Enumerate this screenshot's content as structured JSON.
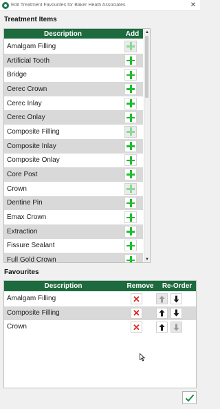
{
  "window": {
    "title": "Edit Treatment Favourites for Baker Heath Associates",
    "close_glyph": "✕",
    "app_icon": "app-logo-icon"
  },
  "treatment_items": {
    "section_title": "Treatment Items",
    "headers": {
      "description": "Description",
      "add": "Add"
    },
    "rows": [
      {
        "label": "Amalgam Filling",
        "add_enabled": false
      },
      {
        "label": "Artificial Tooth",
        "add_enabled": true
      },
      {
        "label": "Bridge",
        "add_enabled": true
      },
      {
        "label": "Cerec Crown",
        "add_enabled": true
      },
      {
        "label": "Cerec Inlay",
        "add_enabled": true
      },
      {
        "label": "Cerec Onlay",
        "add_enabled": true
      },
      {
        "label": "Composite Filling",
        "add_enabled": false
      },
      {
        "label": "Composite Inlay",
        "add_enabled": true
      },
      {
        "label": "Composite Onlay",
        "add_enabled": true
      },
      {
        "label": "Core Post",
        "add_enabled": true
      },
      {
        "label": "Crown",
        "add_enabled": false
      },
      {
        "label": "Dentine Pin",
        "add_enabled": true
      },
      {
        "label": "Emax Crown",
        "add_enabled": true
      },
      {
        "label": "Extraction",
        "add_enabled": true
      },
      {
        "label": "Fissure Sealant",
        "add_enabled": true
      },
      {
        "label": "Full Gold Crown",
        "add_enabled": true
      }
    ],
    "scroll_position": 0.0
  },
  "favourites": {
    "section_title": "Favourites",
    "headers": {
      "description": "Description",
      "remove": "Remove",
      "reorder": "Re-Order"
    },
    "rows": [
      {
        "label": "Amalgam Filling",
        "up_enabled": false,
        "down_enabled": true
      },
      {
        "label": "Composite Filling",
        "up_enabled": true,
        "down_enabled": true
      },
      {
        "label": "Crown",
        "up_enabled": true,
        "down_enabled": false
      }
    ]
  },
  "colors": {
    "header_green": "#1c6a3d",
    "plus_green": "#1fbd2f",
    "remove_red": "#e0241b",
    "row_alt": "#d9d9d9"
  },
  "icons": {
    "add": "plus-icon",
    "remove": "red-x-icon",
    "move_up": "arrow-up-icon",
    "move_down": "arrow-down-icon",
    "ok": "checkmark-icon"
  }
}
